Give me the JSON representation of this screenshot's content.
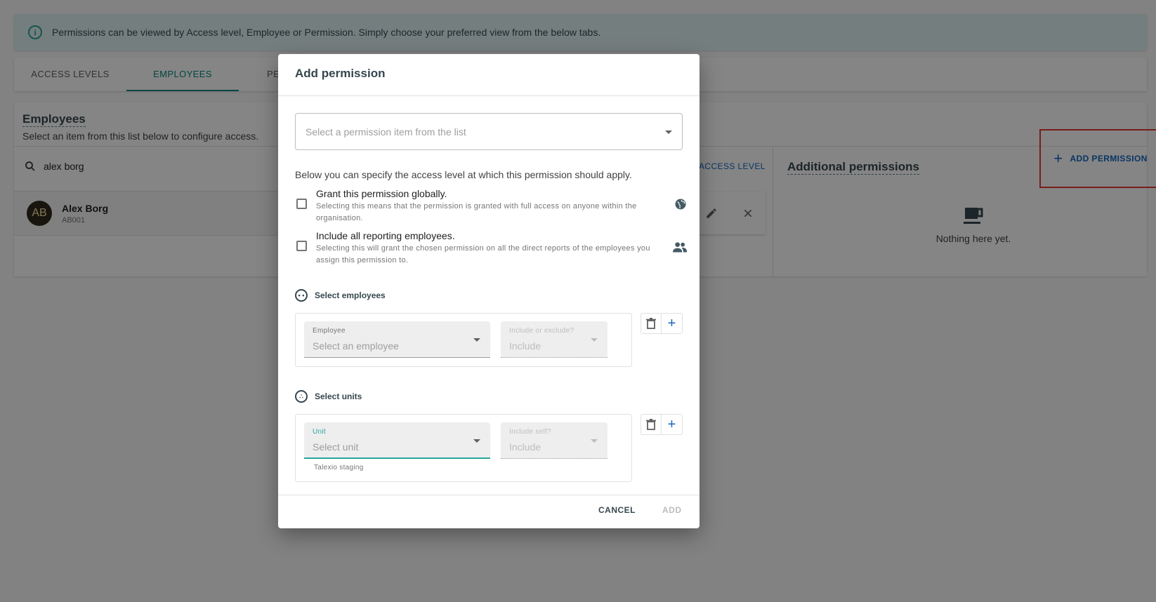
{
  "banner": {
    "text": "Permissions can be viewed by Access level, Employee or Permission. Simply choose your preferred view from the below tabs.",
    "icon": "info-icon"
  },
  "tabs": [
    {
      "label": "ACCESS LEVELS"
    },
    {
      "label": "EMPLOYEES"
    },
    {
      "label": "PE"
    }
  ],
  "employees": {
    "title": "Employees",
    "subtitle": "Select an item from this list below to configure access.",
    "search_value": "alex borg",
    "items": [
      {
        "initials": "AB",
        "name": "Alex Borg",
        "code": "AB001"
      }
    ]
  },
  "access_level_link": "ACCESS LEVEL",
  "additional": {
    "title": "Additional permissions",
    "add_button": "ADD PERMISSION",
    "empty_text": "Nothing here yet."
  },
  "dialog": {
    "title": "Add permission",
    "permission_placeholder": "Select a permission item from the list",
    "description": "Below you can specify the access level at which this permission should apply.",
    "global": {
      "title": "Grant this permission globally.",
      "subtitle": "Selecting this means that the permission is granted with full access on anyone within the organisation."
    },
    "reporting": {
      "title": "Include all reporting employees.",
      "subtitle": "Selecting this will grant the chosen permission on all the direct reports of the employees you assign this permission to."
    },
    "employees_section": {
      "heading": "Select employees",
      "employee_label": "Employee",
      "employee_placeholder": "Select an employee",
      "include_label": "Include or exclude?",
      "include_value": "Include"
    },
    "units_section": {
      "heading": "Select units",
      "unit_label": "Unit",
      "unit_placeholder": "Select unit",
      "unit_hint": "Talexio staging",
      "include_label": "Include self?",
      "include_value": "Include"
    },
    "cancel": "CANCEL",
    "add": "ADD"
  },
  "colors": {
    "accent": "#00897b",
    "link": "#1565c0",
    "highlight": "#e53935"
  }
}
